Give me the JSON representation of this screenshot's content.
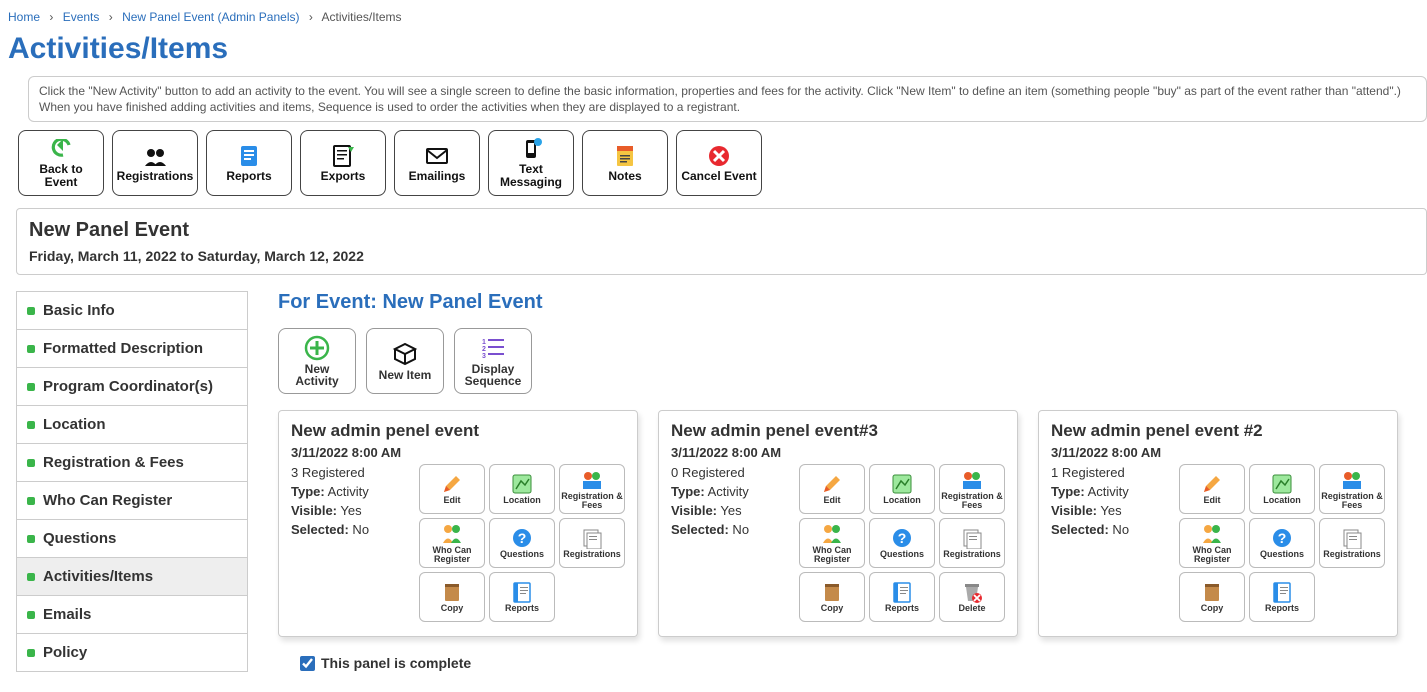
{
  "breadcrumb": {
    "home": "Home",
    "events": "Events",
    "event_link": "New Panel Event (Admin Panels)",
    "current": "Activities/Items"
  },
  "page_title": "Activities/Items",
  "info_text": "Click the \"New Activity\" button to add an activity to the event. You will see a single screen to define the basic information, properties and fees for the activity. Click \"New Item\" to define an item (something people \"buy\" as part of the event rather than \"attend\".) When you have finished adding activities and items, Sequence is used to order the activities when they are displayed to a registrant.",
  "toolbar": {
    "back": "Back to Event",
    "registrations": "Registrations",
    "reports": "Reports",
    "exports": "Exports",
    "emailings": "Emailings",
    "text_messaging": "Text Messaging",
    "notes": "Notes",
    "cancel_event": "Cancel Event"
  },
  "event": {
    "name": "New Panel Event",
    "date_range": "Friday, March 11, 2022 to Saturday, March 12, 2022"
  },
  "side_menu": [
    "Basic Info",
    "Formatted Description",
    "Program Coordinator(s)",
    "Location",
    "Registration & Fees",
    "Who Can Register",
    "Questions",
    "Activities/Items",
    "Emails",
    "Policy"
  ],
  "for_event_prefix": "For Event: ",
  "for_event_name": "New Panel Event",
  "sub_toolbar": {
    "new_activity": "New Activity",
    "new_item": "New Item",
    "display_sequence": "Display Sequence"
  },
  "action_labels": {
    "edit": "Edit",
    "location": "Location",
    "regfees": "Registration & Fees",
    "whocan": "Who Can Register",
    "questions": "Questions",
    "registrations": "Registrations",
    "copy": "Copy",
    "reports": "Reports",
    "delete": "Delete"
  },
  "meta_labels": {
    "type": "Type:",
    "visible": "Visible:",
    "selected": "Selected:"
  },
  "cards": [
    {
      "title": "New admin penel event",
      "date": "3/11/2022 8:00 AM",
      "registered": "3 Registered",
      "type": "Activity",
      "visible": "Yes",
      "selected": "No",
      "has_delete": false
    },
    {
      "title": "New admin penel event#3",
      "date": "3/11/2022 8:00 AM",
      "registered": "0 Registered",
      "type": "Activity",
      "visible": "Yes",
      "selected": "No",
      "has_delete": true
    },
    {
      "title": "New admin penel event #2",
      "date": "3/11/2022 8:00 AM",
      "registered": "1 Registered",
      "type": "Activity",
      "visible": "Yes",
      "selected": "No",
      "has_delete": false
    }
  ],
  "complete_label": "This panel is complete",
  "complete_checked": true
}
